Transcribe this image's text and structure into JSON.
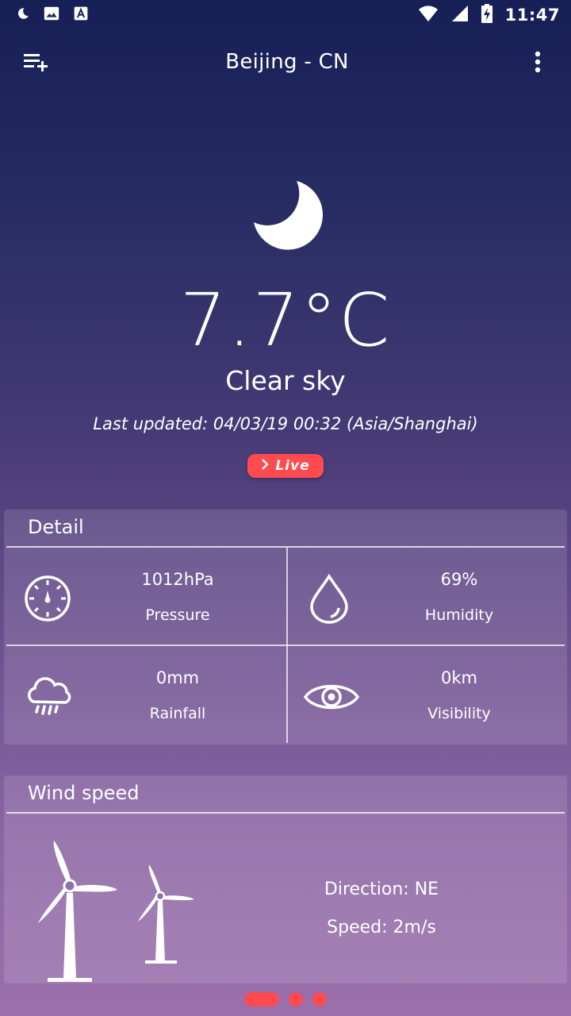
{
  "status_bar": {
    "time": "11:47",
    "left_icons": [
      "moon-icon",
      "image-icon",
      "font-icon"
    ],
    "right_icons": [
      "wifi-icon",
      "signal-icon",
      "battery-charging-icon"
    ]
  },
  "app_bar": {
    "title": "Beijing - CN",
    "left_icon": "playlist-add-icon",
    "right_icon": "more-vert-icon"
  },
  "current": {
    "icon": "moon-icon",
    "temperature": "7.7°C",
    "condition": "Clear sky",
    "last_updated": "Last updated: 04/03/19 00:32 (Asia/Shanghai)",
    "live_label": "Live"
  },
  "detail": {
    "title": "Detail",
    "items": [
      {
        "value": "1012hPa",
        "label": "Pressure",
        "icon": "barometer-icon"
      },
      {
        "value": "69%",
        "label": "Humidity",
        "icon": "water-drop-icon"
      },
      {
        "value": "0mm",
        "label": "Rainfall",
        "icon": "rain-cloud-icon"
      },
      {
        "value": "0km",
        "label": "Visibility",
        "icon": "eye-icon"
      }
    ]
  },
  "wind": {
    "title": "Wind speed",
    "direction": "Direction: NE",
    "speed": "Speed: 2m/s",
    "icon": "wind-turbine-icon"
  },
  "pager": {
    "count": 3,
    "active_index": 0
  },
  "colors": {
    "accent": "#ff4a4f",
    "gradient_top": "#161f56",
    "gradient_bottom": "#9b70ac",
    "text": "#ffffff"
  }
}
